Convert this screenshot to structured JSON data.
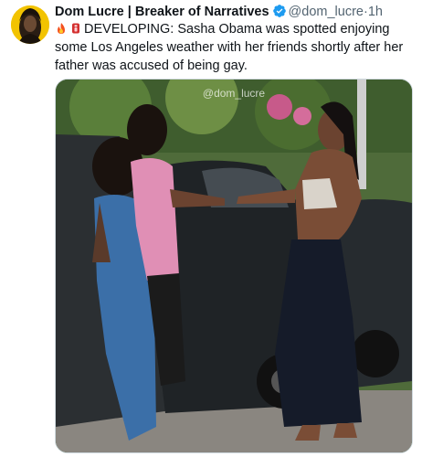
{
  "author": {
    "display_name": "Dom Lucre | Breaker of Narratives",
    "handle": "@dom_lucre",
    "separator": "·",
    "time": "1h",
    "verified_icon": "verified-badge-icon"
  },
  "tweet": {
    "emojis": [
      "fire-emoji-icon",
      "red-alert-emoji-icon"
    ],
    "text": "DEVELOPING: Sasha Obama was spotted enjoying some Los Angeles weather with her friends shortly after her father was accused of being gay."
  },
  "media": {
    "watermark": "@dom_lucre"
  },
  "colors": {
    "verified": "#1d9bf0",
    "handle": "#536471",
    "avatar_bg": "#f2c300"
  }
}
